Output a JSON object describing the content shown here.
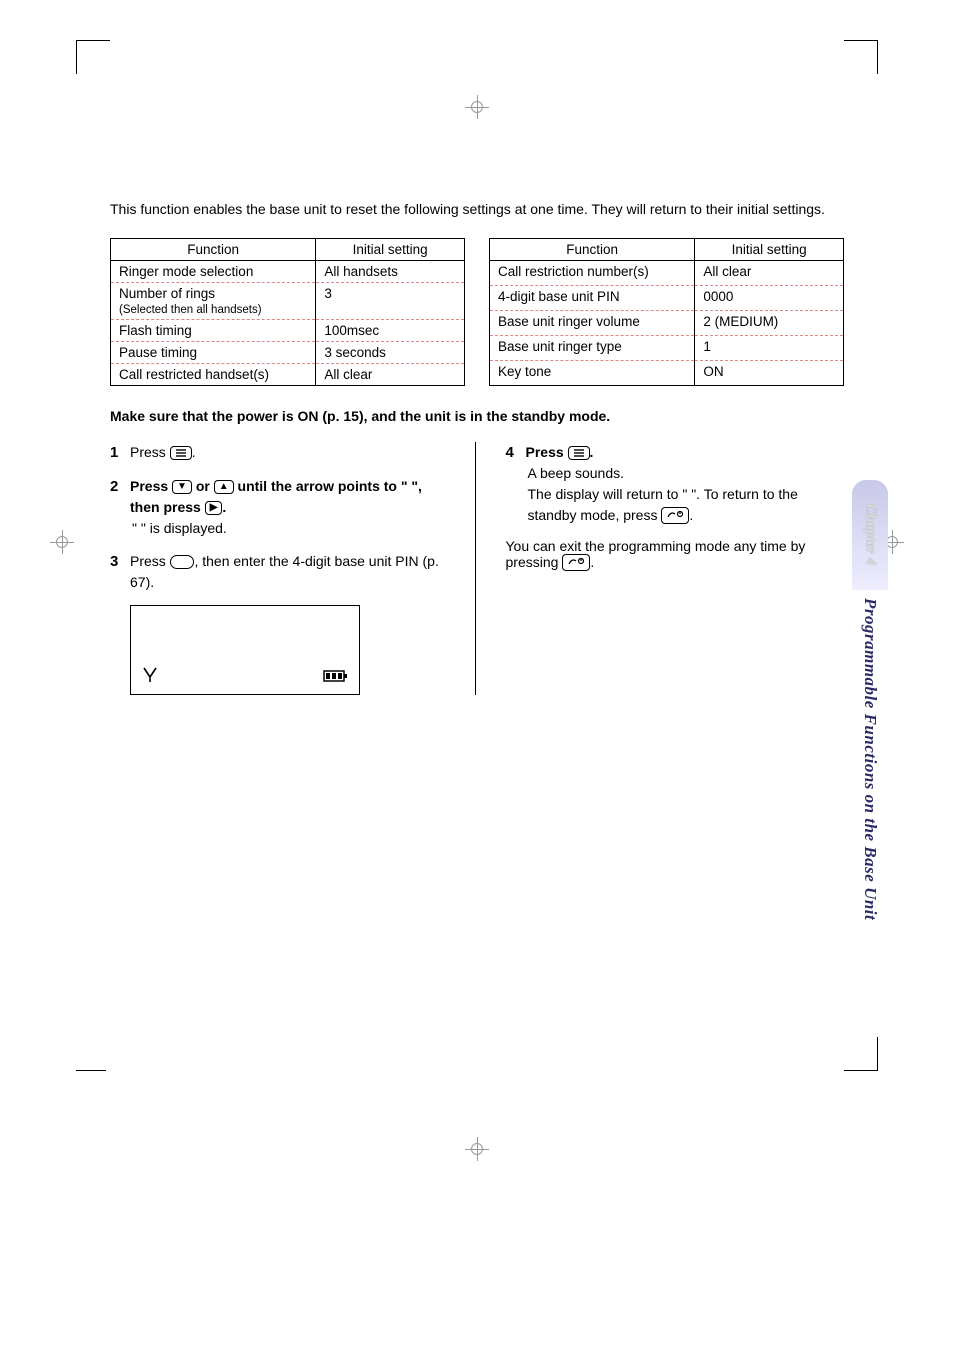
{
  "intro": "This function enables the base unit to reset the following settings at one time. They will return to their initial settings.",
  "table_headers": {
    "function": "Function",
    "initial": "Initial setting"
  },
  "table_left": [
    {
      "fn": "Ringer mode selection",
      "val": "All handsets"
    },
    {
      "fn": "Number of rings",
      "fn_sub": "(Selected then all handsets)",
      "val": "3"
    },
    {
      "fn": "Flash timing",
      "val": "100msec"
    },
    {
      "fn": "Pause timing",
      "val": "3 seconds"
    },
    {
      "fn": "Call restricted handset(s)",
      "val": "All clear"
    }
  ],
  "table_right": [
    {
      "fn": "Call restriction number(s)",
      "val": "All clear"
    },
    {
      "fn": "4-digit base unit PIN",
      "val": "0000"
    },
    {
      "fn": "Base unit ringer volume",
      "val": "2 (MEDIUM)"
    },
    {
      "fn": "Base unit ringer type",
      "val": "1"
    },
    {
      "fn": "Key tone",
      "val": "ON"
    }
  ],
  "instruction_title": "Make sure that the power is ON (p. 15), and the unit is in the standby mode.",
  "steps_left": {
    "s1": {
      "num": "1",
      "text_a": "Press ",
      "text_b": "."
    },
    "s2": {
      "num": "2",
      "text_a": "Press ",
      "text_b": " or ",
      "text_c": " until the arrow points to \"",
      "text_d": "\", then press ",
      "text_e": ".",
      "sub_a": "\"",
      "sub_b": "\" is displayed."
    },
    "s3": {
      "num": "3",
      "text_a": "Press ",
      "text_b": ", then enter the 4-digit base unit PIN (p. 67)."
    }
  },
  "steps_right": {
    "s4": {
      "num": "4",
      "text_a": "Press ",
      "text_b": ".",
      "sub1": "A beep sounds.",
      "sub2_a": "The display will return to \"",
      "sub2_b": "\". To return to the standby mode, press ",
      "sub2_c": ".",
      "exit_a": "You can exit the programming mode any time by pressing ",
      "exit_b": "."
    }
  },
  "sidebar": {
    "chapter": "Chapter 4",
    "title": "Programmable Functions on the Base Unit"
  }
}
